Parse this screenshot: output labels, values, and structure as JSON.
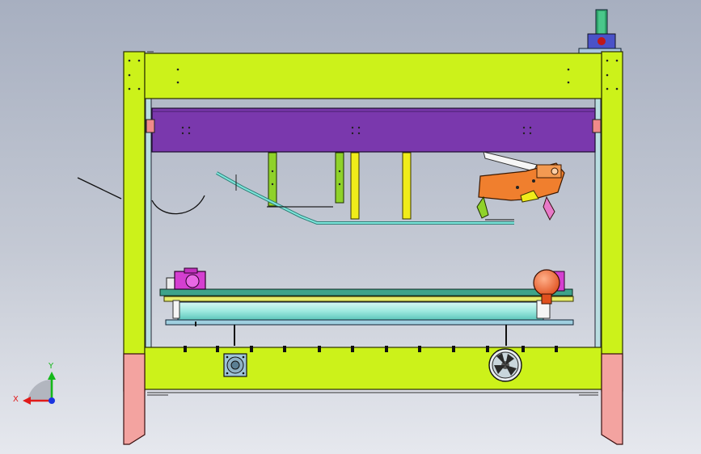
{
  "viewport": {
    "colors": {
      "frame": "#ccf21a",
      "frame_stroke": "#2a2f00",
      "purple_beam": "#7a38ad",
      "foot": "#f3a3a0",
      "orange_mechanism": "#f07f2e",
      "magenta_motor": "#d43fd0",
      "green_bracket": "#8fd22a",
      "yellow_rod": "#f0ec1a",
      "cyan_rail": "#7fe6dc",
      "teal_plate": "#3ea38a"
    },
    "icons": [
      "triad-icon",
      "fan-icon",
      "flange-icon",
      "motor-icon"
    ]
  },
  "triad": {
    "y_label": "Y",
    "x_label": "X",
    "y_color": "#14b81a",
    "x_color": "#e01a1a",
    "z_color": "#1a34e0"
  }
}
